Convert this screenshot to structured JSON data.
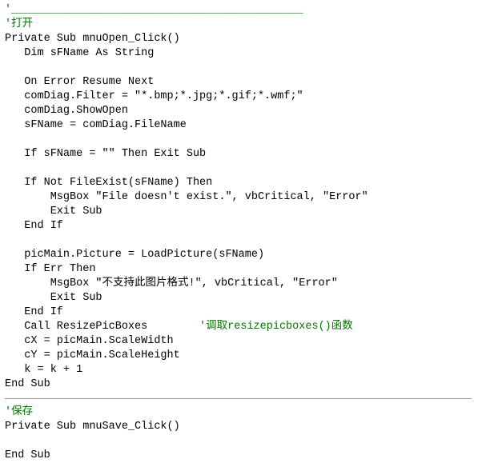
{
  "document": {
    "type": "vb6-code-listing",
    "font_color": "#000000",
    "comment_color": "#007700",
    "separator_color": "#999999",
    "block1": {
      "lines": [
        {
          "kind": "comment",
          "text": "'_____________________________________________"
        },
        {
          "kind": "comment",
          "text": "'打开"
        },
        {
          "kind": "code",
          "text": "Private Sub mnuOpen_Click()"
        },
        {
          "kind": "code",
          "text": "   Dim sFName As String"
        },
        {
          "kind": "blank",
          "text": ""
        },
        {
          "kind": "code",
          "text": "   On Error Resume Next"
        },
        {
          "kind": "code",
          "text": "   comDiag.Filter = \"*.bmp;*.jpg;*.gif;*.wmf;\""
        },
        {
          "kind": "code",
          "text": "   comDiag.ShowOpen"
        },
        {
          "kind": "code",
          "text": "   sFName = comDiag.FileName"
        },
        {
          "kind": "blank",
          "text": ""
        },
        {
          "kind": "code",
          "text": "   If sFName = \"\" Then Exit Sub"
        },
        {
          "kind": "blank",
          "text": ""
        },
        {
          "kind": "code",
          "text": "   If Not FileExist(sFName) Then"
        },
        {
          "kind": "code",
          "text": "       MsgBox \"File doesn't exist.\", vbCritical, \"Error\""
        },
        {
          "kind": "code",
          "text": "       Exit Sub"
        },
        {
          "kind": "code",
          "text": "   End If"
        },
        {
          "kind": "blank",
          "text": ""
        },
        {
          "kind": "code",
          "text": "   picMain.Picture = LoadPicture(sFName)"
        },
        {
          "kind": "code",
          "text": "   If Err Then"
        },
        {
          "kind": "code",
          "text": "       MsgBox \"不支持此图片格式!\", vbCritical, \"Error\""
        },
        {
          "kind": "code",
          "text": "       Exit Sub"
        },
        {
          "kind": "code",
          "text": "   End If"
        },
        {
          "kind": "mixed",
          "code": "   Call ResizePicBoxes",
          "gap": "        ",
          "comment": "'调取resizepicboxes()函数"
        },
        {
          "kind": "code",
          "text": "   cX = picMain.ScaleWidth"
        },
        {
          "kind": "code",
          "text": "   cY = picMain.ScaleHeight"
        },
        {
          "kind": "code",
          "text": "   k = k + 1"
        },
        {
          "kind": "code",
          "text": "End Sub"
        }
      ]
    },
    "block2": {
      "lines": [
        {
          "kind": "comment",
          "text": "'保存"
        },
        {
          "kind": "code",
          "text": "Private Sub mnuSave_Click()"
        },
        {
          "kind": "blank",
          "text": ""
        },
        {
          "kind": "code",
          "text": "End Sub"
        }
      ]
    }
  }
}
